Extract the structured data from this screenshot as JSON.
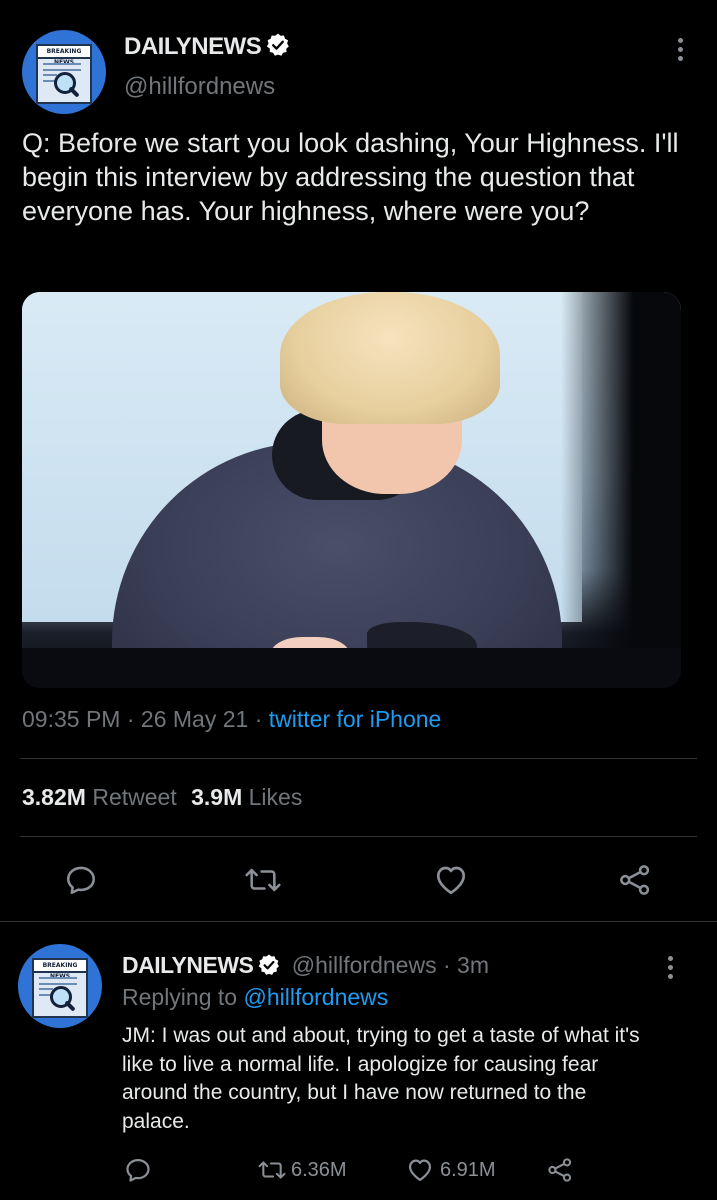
{
  "tweet": {
    "avatar_text": "BREAKING NEWS",
    "display_name": "DAILYNEWS",
    "handle": "@hillfordnews",
    "text": "Q: Before we start you look dashing, Your Highness. I'll begin this interview by addressing the question that everyone has. Your highness, where were you?",
    "time": "09:35 PM",
    "date": "26 May 21",
    "sep1": "·",
    "sep2": "·",
    "source": "twitter for iPhone",
    "retweet_count": "3.82M",
    "retweet_label": "Retweet",
    "like_count": "3.9M",
    "like_label": "Likes"
  },
  "reply": {
    "avatar_text": "BREAKING NEWS",
    "display_name": "DAILYNEWS",
    "handle": "@hillfordnews",
    "sep": "·",
    "age": "3m",
    "replying_label": "Replying to",
    "replying_handle": "@hillfordnews",
    "text": "JM: I was out and about, trying to get a taste of what it's like to live a normal life. I apologize for causing fear around the country, but I have now returned to the palace.",
    "retweets": "6.36M",
    "likes": "6.91M"
  },
  "icons": {
    "verified": "verified-badge-icon",
    "more": "more-vertical-icon",
    "reply": "reply-icon",
    "retweet": "retweet-icon",
    "like": "heart-icon",
    "share": "share-icon"
  },
  "colors": {
    "background": "#000000",
    "text": "#e7e9ea",
    "secondary": "#71767b",
    "link": "#1d9bf0",
    "divider": "#2f3336"
  }
}
